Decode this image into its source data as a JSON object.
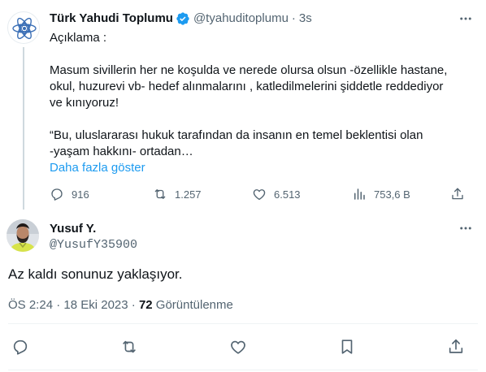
{
  "main_tweet": {
    "display_name": "Türk Yahudi Toplumu",
    "handle": "@tyahuditoplumu",
    "separator": "·",
    "time": "3s",
    "lines": [
      "Açıklama :",
      "",
      "Masum sivillerin her ne koşulda ve nerede olursa olsun -özellikle hastane,",
      "okul, huzurevi vb- hedef alınmalarını , katledilmelerini şiddetle reddediyor",
      "ve kınıyoruz!",
      "",
      "“Bu, uluslararası hukuk tarafından da insanın en temel beklentisi olan",
      "-yaşam hakkını- ortadan…"
    ],
    "show_more": "Daha fazla göster",
    "stats": {
      "replies": "916",
      "retweets": "1.257",
      "likes": "6.513",
      "views": "753,6 B"
    }
  },
  "reply_tweet": {
    "display_name": "Yusuf Y.",
    "handle": "@YusufY35900",
    "text": "Az kaldı sonunuz yaklaşıyor.",
    "time": "ÖS 2:24 · 18 Eki 2023 ·",
    "view_count": "72",
    "view_label": "Görüntülenme"
  },
  "colors": {
    "text": "#0f1419",
    "secondary": "#536471",
    "link": "#1d9bf0",
    "verified_badge": "#1d9bf0"
  },
  "icons": [
    "verified-badge-icon",
    "more-icon",
    "reply-icon",
    "retweet-icon",
    "like-icon",
    "views-icon",
    "share-icon",
    "bookmark-icon"
  ]
}
